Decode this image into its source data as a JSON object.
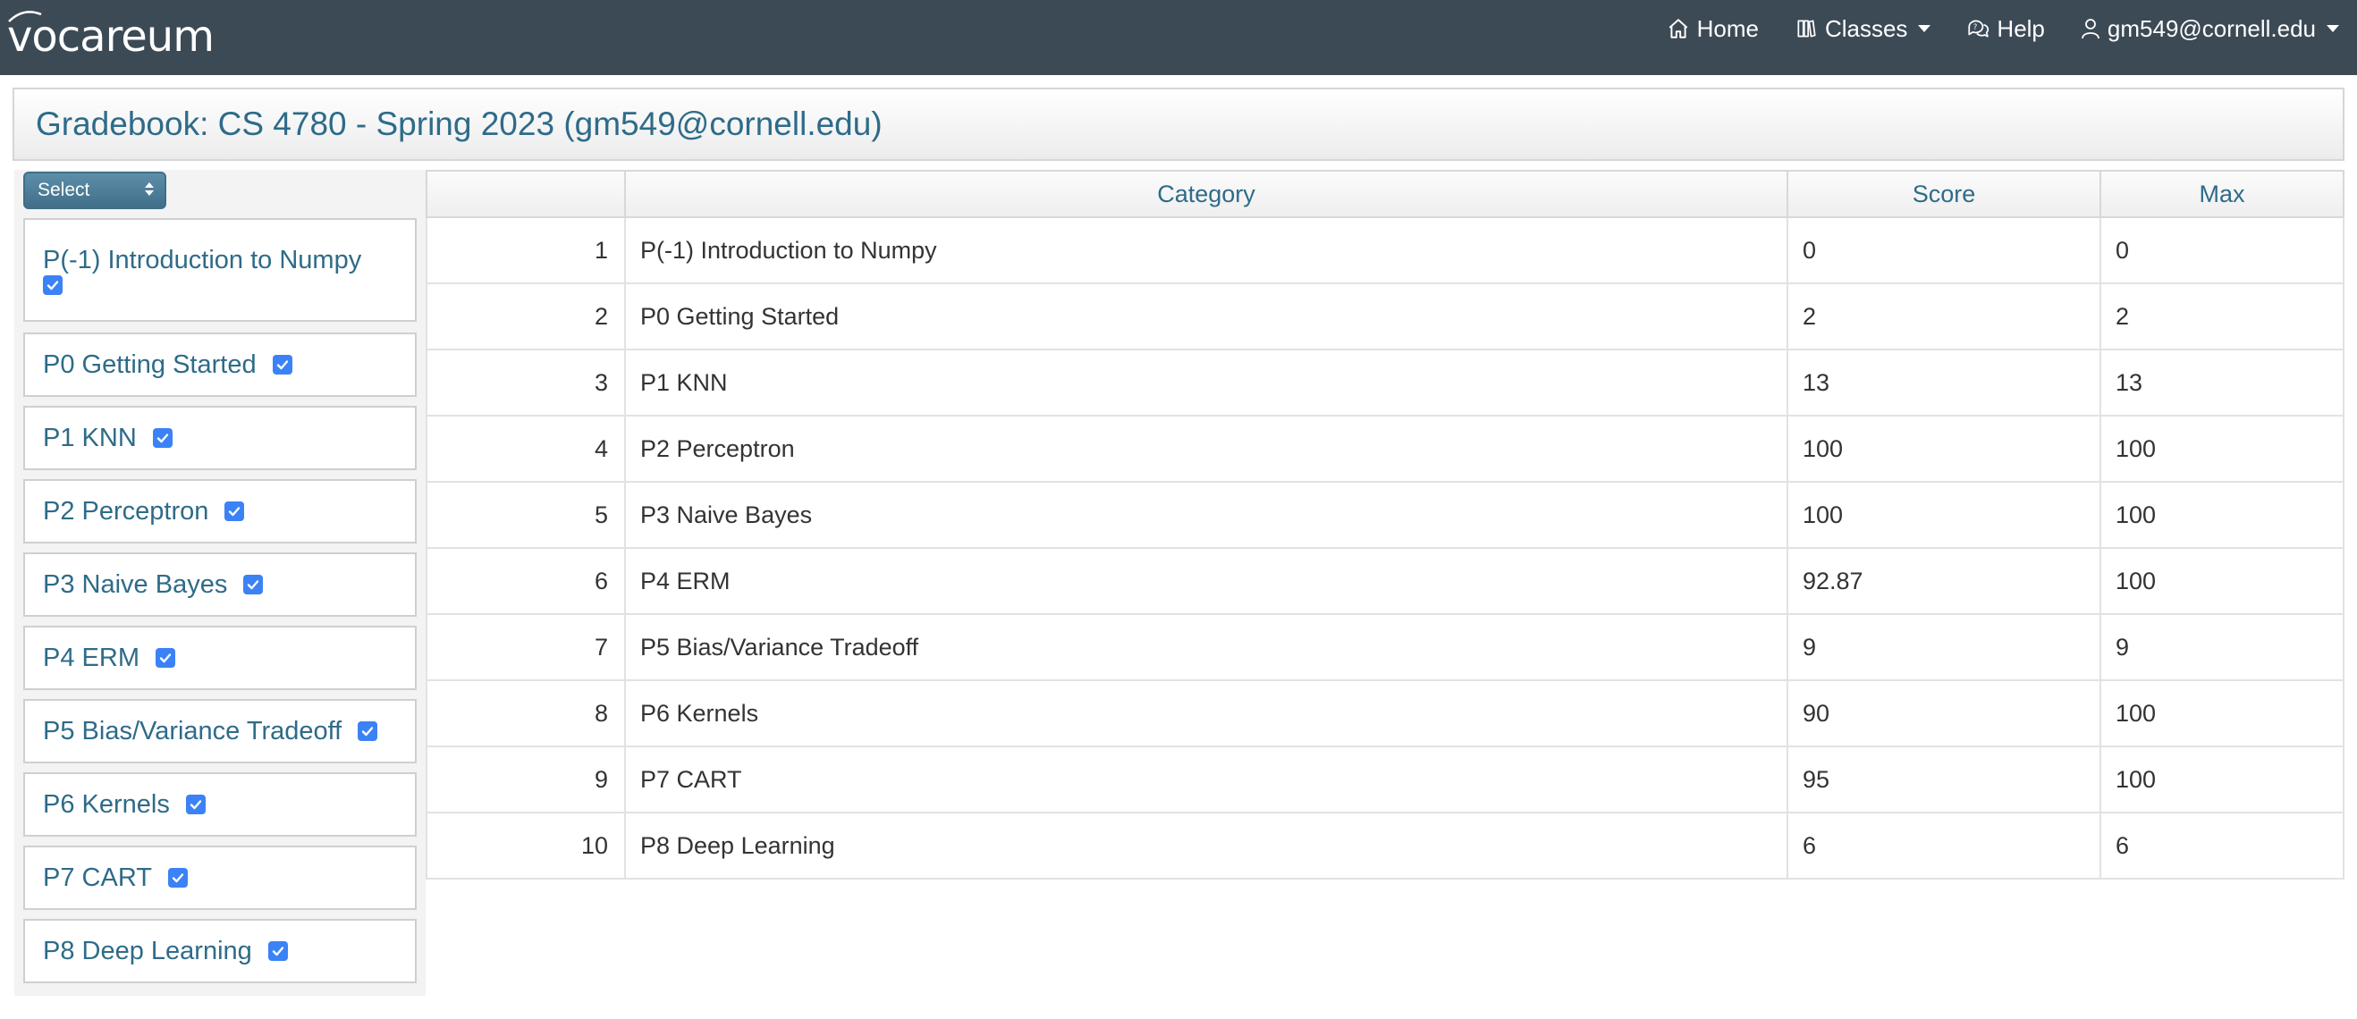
{
  "navbar": {
    "logo": "vocareum",
    "items": [
      {
        "label": "Home",
        "icon": "home-icon"
      },
      {
        "label": "Classes",
        "icon": "book-icon",
        "dropdown": true
      },
      {
        "label": "Help",
        "icon": "help-icon"
      },
      {
        "label": "gm549@cornell.edu",
        "icon": "user-icon",
        "dropdown": true
      }
    ]
  },
  "header": {
    "title": "Gradebook: CS 4780 - Spring 2023 (gm549@cornell.edu)"
  },
  "sidebar": {
    "select_label": "Select",
    "categories": [
      {
        "label": "P(-1) Introduction to Numpy",
        "checked": true
      },
      {
        "label": "P0 Getting Started",
        "checked": true
      },
      {
        "label": "P1 KNN",
        "checked": true
      },
      {
        "label": "P2 Perceptron",
        "checked": true
      },
      {
        "label": "P3 Naive Bayes",
        "checked": true
      },
      {
        "label": "P4 ERM",
        "checked": true
      },
      {
        "label": "P5 Bias/Variance Tradeoff",
        "checked": true
      },
      {
        "label": "P6 Kernels",
        "checked": true
      },
      {
        "label": "P7 CART",
        "checked": true
      },
      {
        "label": "P8 Deep Learning",
        "checked": true
      }
    ]
  },
  "table": {
    "columns": [
      "",
      "Category",
      "Score",
      "Max"
    ],
    "rows": [
      {
        "n": "1",
        "category": "P(-1) Introduction to Numpy",
        "score": "0",
        "max": "0"
      },
      {
        "n": "2",
        "category": "P0 Getting Started",
        "score": "2",
        "max": "2"
      },
      {
        "n": "3",
        "category": "P1 KNN",
        "score": "13",
        "max": "13"
      },
      {
        "n": "4",
        "category": "P2 Perceptron",
        "score": "100",
        "max": "100"
      },
      {
        "n": "5",
        "category": "P3 Naive Bayes",
        "score": "100",
        "max": "100"
      },
      {
        "n": "6",
        "category": "P4 ERM",
        "score": "92.87",
        "max": "100"
      },
      {
        "n": "7",
        "category": "P5 Bias/Variance Tradeoff",
        "score": "9",
        "max": "9"
      },
      {
        "n": "8",
        "category": "P6 Kernels",
        "score": "90",
        "max": "100"
      },
      {
        "n": "9",
        "category": "P7 CART",
        "score": "95",
        "max": "100"
      },
      {
        "n": "10",
        "category": "P8 Deep Learning",
        "score": "6",
        "max": "6"
      }
    ]
  },
  "colors": {
    "navbar_bg": "#3c4a56",
    "link": "#2e6b89",
    "checkbox": "#3b82f6"
  }
}
